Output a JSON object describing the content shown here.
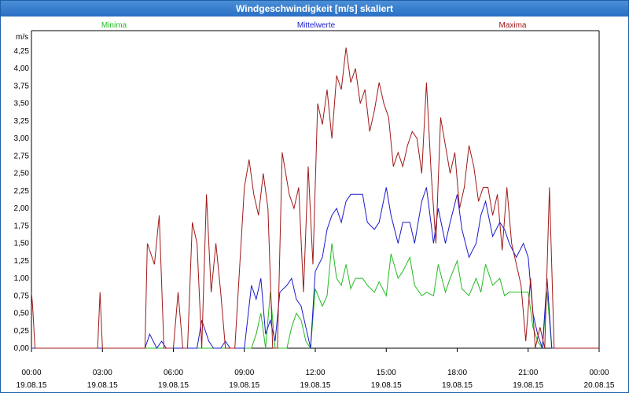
{
  "window": {
    "title": "Windgeschwindigkeit [m/s] skaliert"
  },
  "chart_data": {
    "type": "line",
    "title": "Windgeschwindigkeit [m/s] skaliert",
    "ylabel": "m/s",
    "xlabel": "",
    "ylim": [
      0,
      4.5
    ],
    "xlim_hours": [
      0,
      24
    ],
    "grid": true,
    "legend_placement": "top",
    "y_ticks": [
      "0,00",
      "0,25",
      "0,50",
      "0,75",
      "1,00",
      "1,25",
      "1,50",
      "1,75",
      "2,00",
      "2,25",
      "2,50",
      "2,75",
      "3,00",
      "3,25",
      "3,50",
      "3,75",
      "4,00",
      "4,25"
    ],
    "x_ticks": [
      {
        "time": "00:00",
        "date": "19.08.15"
      },
      {
        "time": "03:00",
        "date": "19.08.15"
      },
      {
        "time": "06:00",
        "date": "19.08.15"
      },
      {
        "time": "09:00",
        "date": "19.08.15"
      },
      {
        "time": "12:00",
        "date": "19.08.15"
      },
      {
        "time": "15:00",
        "date": "19.08.15"
      },
      {
        "time": "18:00",
        "date": "19.08.15"
      },
      {
        "time": "21:00",
        "date": "19.08.15"
      },
      {
        "time": "00:00",
        "date": "20.08.15"
      }
    ],
    "series": [
      {
        "name": "Minima",
        "color": "#22bb22",
        "x": [
          0,
          9.0,
          9.3,
          9.5,
          9.7,
          9.9,
          10.1,
          10.3,
          10.5,
          10.8,
          11.0,
          11.2,
          11.4,
          11.6,
          11.8,
          12.0,
          12.3,
          12.5,
          12.7,
          12.9,
          13.1,
          13.3,
          13.5,
          13.7,
          14.0,
          14.2,
          14.5,
          14.7,
          15.0,
          15.2,
          15.5,
          15.7,
          16.0,
          16.2,
          16.5,
          16.7,
          17.0,
          17.2,
          17.5,
          17.7,
          18.0,
          18.2,
          18.5,
          18.8,
          19.0,
          19.2,
          19.5,
          19.8,
          20.0,
          20.2,
          20.5,
          20.8,
          21.0,
          21.2,
          21.4,
          21.6,
          21.8,
          22.0,
          24
        ],
        "values": [
          0,
          0,
          0,
          0.2,
          0.5,
          0,
          0.8,
          0,
          0,
          0,
          0.3,
          0.5,
          0.4,
          0.1,
          0,
          0.85,
          0.6,
          0.75,
          1.5,
          1.0,
          0.9,
          1.2,
          0.85,
          1.0,
          1.0,
          0.9,
          0.8,
          0.95,
          0.75,
          1.35,
          1.0,
          1.1,
          1.3,
          0.9,
          0.75,
          0.8,
          0.75,
          1.2,
          0.8,
          1.0,
          1.25,
          0.85,
          0.75,
          1.0,
          0.8,
          1.2,
          0.9,
          1.0,
          0.75,
          0.8,
          0.8,
          0.8,
          0.8,
          0.3,
          0.1,
          0,
          0.8,
          0,
          0
        ]
      },
      {
        "name": "Mittelwerte",
        "color": "#1a1acc",
        "x": [
          0,
          4.8,
          5.0,
          5.3,
          5.5,
          5.7,
          6.0,
          7.0,
          7.2,
          7.5,
          7.7,
          8.0,
          8.2,
          8.4,
          8.6,
          9.0,
          9.3,
          9.5,
          9.7,
          9.9,
          10.1,
          10.3,
          10.5,
          10.8,
          11.0,
          11.2,
          11.4,
          11.6,
          11.8,
          12.0,
          12.3,
          12.5,
          12.7,
          12.9,
          13.1,
          13.3,
          13.5,
          13.7,
          14.0,
          14.2,
          14.5,
          14.7,
          15.0,
          15.2,
          15.5,
          15.7,
          16.0,
          16.2,
          16.5,
          16.7,
          17.0,
          17.2,
          17.5,
          17.7,
          18.0,
          18.2,
          18.5,
          18.8,
          19.0,
          19.2,
          19.5,
          19.8,
          20.0,
          20.2,
          20.5,
          20.8,
          21.0,
          21.2,
          21.4,
          21.6,
          21.8,
          22.0,
          24
        ],
        "values": [
          0,
          0,
          0.2,
          0,
          0.1,
          0,
          0,
          0,
          0.4,
          0.1,
          0,
          0,
          0.1,
          0,
          0,
          0,
          0.9,
          0.7,
          1.0,
          0.2,
          0.4,
          0.1,
          0.8,
          0.9,
          1.0,
          0.7,
          0.6,
          0.3,
          0,
          1.1,
          1.3,
          1.7,
          1.9,
          2.0,
          1.8,
          2.1,
          2.2,
          2.2,
          2.2,
          1.8,
          1.7,
          1.8,
          2.3,
          1.9,
          1.5,
          1.8,
          1.8,
          1.5,
          2.1,
          2.3,
          1.5,
          2.0,
          1.5,
          1.8,
          2.2,
          1.7,
          1.3,
          1.5,
          1.9,
          2.1,
          1.6,
          1.8,
          1.7,
          1.5,
          1.3,
          1.5,
          1.3,
          0.5,
          0.2,
          0,
          1.0,
          0,
          0
        ]
      },
      {
        "name": "Maxima",
        "color": "#a01818",
        "x": [
          0,
          0.05,
          0.15,
          2.8,
          2.9,
          3.0,
          4.8,
          4.9,
          5.2,
          5.4,
          5.6,
          5.8,
          6.0,
          6.2,
          6.4,
          6.6,
          6.8,
          7.0,
          7.2,
          7.4,
          7.6,
          7.8,
          8.0,
          8.2,
          8.4,
          8.6,
          9.0,
          9.2,
          9.4,
          9.6,
          9.8,
          10.0,
          10.2,
          10.4,
          10.6,
          10.9,
          11.1,
          11.3,
          11.5,
          11.7,
          11.9,
          12.1,
          12.3,
          12.5,
          12.7,
          12.9,
          13.1,
          13.3,
          13.5,
          13.7,
          13.9,
          14.1,
          14.3,
          14.5,
          14.7,
          14.9,
          15.1,
          15.3,
          15.5,
          15.7,
          15.9,
          16.1,
          16.3,
          16.5,
          16.7,
          16.9,
          17.1,
          17.3,
          17.5,
          17.7,
          17.9,
          18.1,
          18.3,
          18.5,
          18.7,
          18.9,
          19.1,
          19.3,
          19.5,
          19.7,
          19.9,
          20.1,
          20.3,
          20.5,
          20.7,
          20.9,
          21.1,
          21.3,
          21.5,
          21.7,
          21.9,
          22.1,
          24
        ],
        "values": [
          0.8,
          0.6,
          0,
          0,
          0.8,
          0,
          0,
          1.5,
          1.2,
          1.9,
          0,
          0,
          0,
          0.8,
          0,
          0,
          1.8,
          1.5,
          0,
          2.2,
          0.8,
          1.5,
          0.8,
          0,
          0,
          0,
          2.3,
          2.7,
          2.2,
          1.9,
          2.5,
          2.0,
          0,
          0,
          2.8,
          2.2,
          2.0,
          2.3,
          0.8,
          2.6,
          1.2,
          3.5,
          3.2,
          3.7,
          3.0,
          3.9,
          3.7,
          4.3,
          3.8,
          4.0,
          3.5,
          3.7,
          3.1,
          3.4,
          3.8,
          3.5,
          3.3,
          2.6,
          2.8,
          2.6,
          2.9,
          3.1,
          3.0,
          2.5,
          3.8,
          2.5,
          1.5,
          3.3,
          2.9,
          2.5,
          2.8,
          2.0,
          2.3,
          2.9,
          2.6,
          2.1,
          2.3,
          2.3,
          1.9,
          2.2,
          1.4,
          2.3,
          1.5,
          1.2,
          0.9,
          0.1,
          1.0,
          0,
          0.3,
          0,
          2.3,
          0,
          0
        ]
      }
    ]
  }
}
